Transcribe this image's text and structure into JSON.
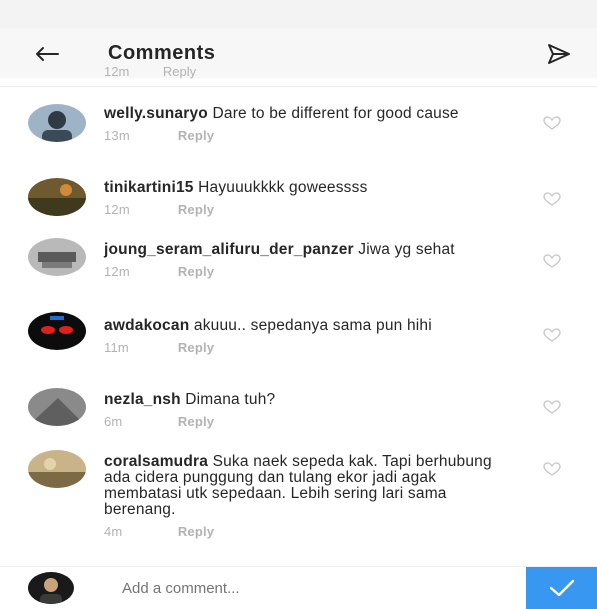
{
  "header": {
    "title": "Comments"
  },
  "partial": {
    "time": "12m",
    "reply": "Reply"
  },
  "comments": [
    {
      "username": "welly.sunaryo",
      "text": "Dare to be different for good cause",
      "time": "13m",
      "reply": "Reply"
    },
    {
      "username": "tinikartini15",
      "text": "Hayuuukkkk goweessss",
      "time": "12m",
      "reply": "Reply"
    },
    {
      "username": "joung_seram_alifuru_der_panzer",
      "text": "Jiwa yg sehat",
      "time": "12m",
      "reply": "Reply"
    },
    {
      "username": "awdakocan",
      "text": "akuuu.. sepedanya sama pun hihi",
      "time": "11m",
      "reply": "Reply"
    },
    {
      "username": "nezla_nsh",
      "text": "Dimana tuh?",
      "time": "6m",
      "reply": "Reply"
    },
    {
      "username": "coralsamudra",
      "text": "Suka naek sepeda kak. Tapi berhubung ada cidera punggung dan tulang ekor jadi agak membatasi utk sepedaan. Lebih sering lari sama berenang.",
      "time": "4m",
      "reply": "Reply"
    }
  ],
  "composer": {
    "placeholder": "Add a comment..."
  },
  "colors": {
    "accent": "#3897f0",
    "meta": "#b3b3b3",
    "header_bg": "#f7f7f7"
  },
  "icons": {
    "back": "arrow-left-icon",
    "send": "paper-plane-icon",
    "like": "heart-outline-icon",
    "post": "checkmark-icon"
  }
}
